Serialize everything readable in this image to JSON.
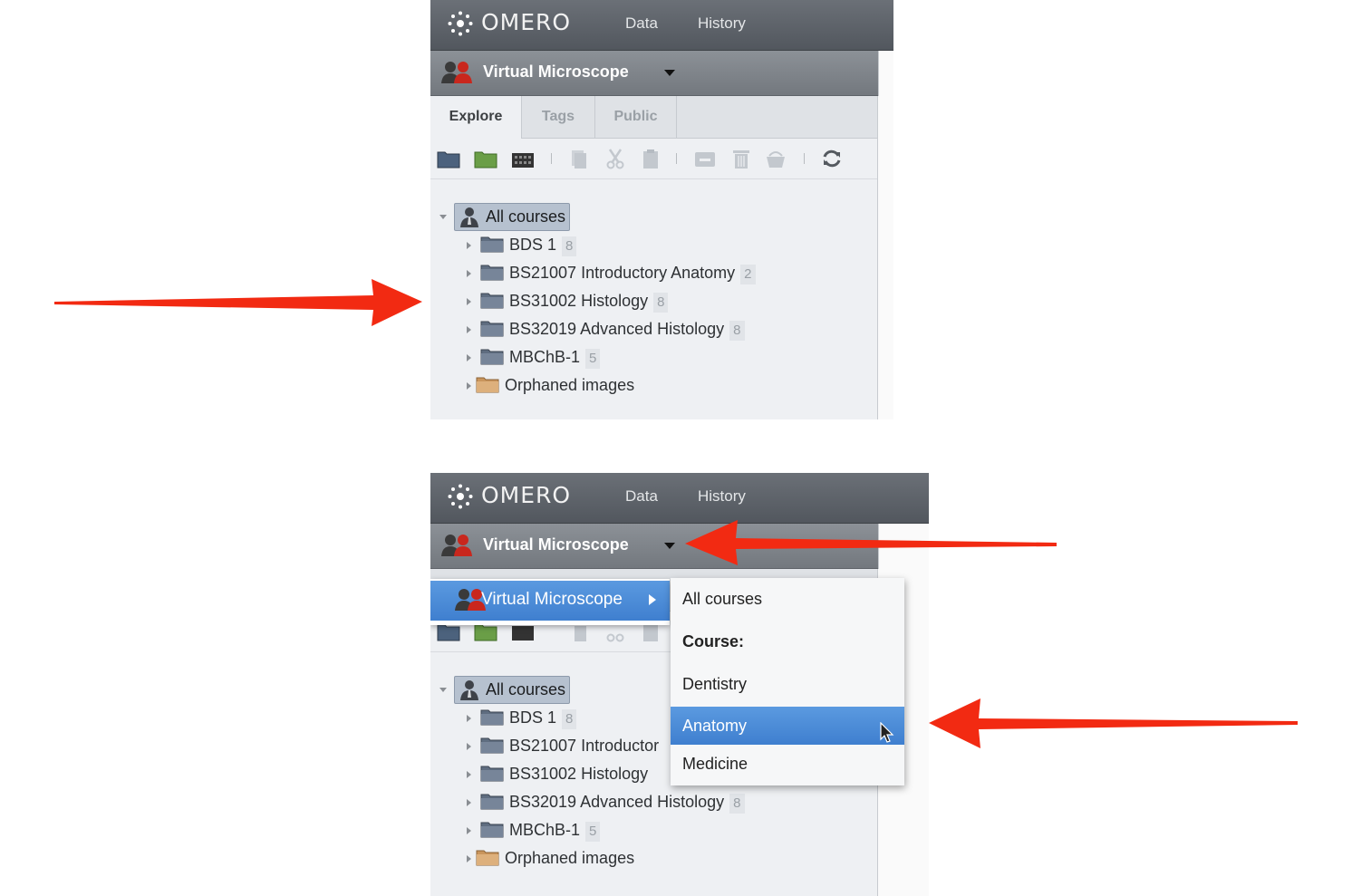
{
  "app": {
    "logo_text": "OMERO",
    "nav": [
      "Data",
      "History"
    ]
  },
  "group": {
    "name": "Virtual Microscope"
  },
  "tabs": [
    "Explore",
    "Tags",
    "Public"
  ],
  "tree": {
    "root_label": "All courses",
    "items": [
      {
        "label": "BDS 1",
        "count": "8"
      },
      {
        "label": "BS21007 Introductory Anatomy",
        "count": "2"
      },
      {
        "label": "BS31002 Histology",
        "count": "8"
      },
      {
        "label": "BS32019 Advanced Histology",
        "count": "8"
      },
      {
        "label": "MBChB-1",
        "count": "5"
      },
      {
        "label": "Orphaned images",
        "count": ""
      }
    ]
  },
  "bottom_tree": {
    "items": [
      {
        "label": "BDS 1",
        "count": "8"
      },
      {
        "label": "BS21007 Introductor",
        "count": ""
      },
      {
        "label": "BS31002 Histology",
        "count": ""
      },
      {
        "label": "BS32019 Advanced Histology",
        "count": "8"
      },
      {
        "label": "MBChB-1",
        "count": "5"
      },
      {
        "label": "Orphaned images",
        "count": ""
      }
    ]
  },
  "menu": {
    "group_item": "Virtual Microscope",
    "submenu": [
      {
        "label": "All courses",
        "type": "item"
      },
      {
        "label": "Course:",
        "type": "header"
      },
      {
        "label": "Dentistry",
        "type": "item"
      },
      {
        "label": "Anatomy",
        "type": "selected"
      },
      {
        "label": "Medicine",
        "type": "item"
      }
    ]
  },
  "colors": {
    "annotation_arrow": "#f22a12",
    "menu_highlight": "#3f7fcf",
    "topbar": "#5d6269"
  },
  "icons": [
    "omero-logo-icon",
    "group-users-icon",
    "new-project-icon",
    "new-dataset-icon",
    "new-screen-icon",
    "copy-icon",
    "cut-icon",
    "paste-icon",
    "remove-icon",
    "delete-icon",
    "chgrp-icon",
    "refresh-icon",
    "folder-icon",
    "orphaned-folder-icon",
    "user-icon",
    "mouse-cursor-icon"
  ]
}
